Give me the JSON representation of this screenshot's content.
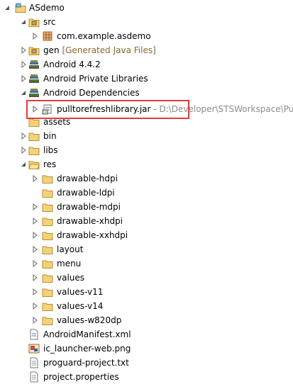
{
  "tree": {
    "project": {
      "label": "ASdemo",
      "icon": "project-icon",
      "twisty": "expanded"
    },
    "src": {
      "label": "src",
      "icon": "source-folder-icon",
      "twisty": "expanded"
    },
    "package": {
      "label": "com.example.asdemo",
      "icon": "package-icon",
      "twisty": "collapsed"
    },
    "gen": {
      "label": "gen",
      "decoration": "[Generated Java Files]",
      "icon": "gen-folder-icon",
      "twisty": "collapsed"
    },
    "android_lib": {
      "label": "Android 4.4.2",
      "icon": "library-icon",
      "twisty": "collapsed"
    },
    "private_libs": {
      "label": "Android Private Libraries",
      "icon": "library-icon",
      "twisty": "collapsed"
    },
    "dependencies": {
      "label": "Android Dependencies",
      "icon": "library-icon",
      "twisty": "expanded"
    },
    "jar": {
      "label": "pulltorefreshlibrary.jar",
      "separator": " - ",
      "path": "D:\\Developer\\STSWorkspace\\Pu",
      "icon": "jar-icon",
      "twisty": "collapsed"
    },
    "assets": {
      "label": "assets",
      "icon": "folder-icon"
    },
    "bin": {
      "label": "bin",
      "icon": "folder-icon",
      "twisty": "collapsed"
    },
    "libs": {
      "label": "libs",
      "icon": "folder-icon",
      "twisty": "collapsed"
    },
    "res": {
      "label": "res",
      "icon": "folder-icon",
      "twisty": "expanded"
    },
    "res_children": [
      {
        "label": "drawable-hdpi",
        "twisty": "collapsed"
      },
      {
        "label": "drawable-ldpi",
        "twisty": "none"
      },
      {
        "label": "drawable-mdpi",
        "twisty": "collapsed"
      },
      {
        "label": "drawable-xhdpi",
        "twisty": "collapsed"
      },
      {
        "label": "drawable-xxhdpi",
        "twisty": "collapsed"
      },
      {
        "label": "layout",
        "twisty": "collapsed"
      },
      {
        "label": "menu",
        "twisty": "collapsed"
      },
      {
        "label": "values",
        "twisty": "collapsed"
      },
      {
        "label": "values-v11",
        "twisty": "collapsed"
      },
      {
        "label": "values-v14",
        "twisty": "collapsed"
      },
      {
        "label": "values-w820dp",
        "twisty": "collapsed"
      }
    ],
    "manifest": {
      "label": "AndroidManifest.xml",
      "icon": "xml-file-icon"
    },
    "launcher": {
      "label": "ic_launcher-web.png",
      "icon": "image-file-icon"
    },
    "proguard": {
      "label": "proguard-project.txt",
      "icon": "text-file-icon"
    },
    "properties": {
      "label": "project.properties",
      "icon": "properties-file-icon"
    }
  },
  "colors": {
    "highlight_border": "#e03c3c",
    "decoration_text": "#8a6a2c",
    "path_text": "#8c8c8c",
    "folder_fill": "#f3d27a",
    "folder_stroke": "#b8902e"
  }
}
